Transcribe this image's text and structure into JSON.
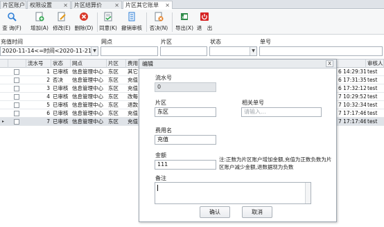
{
  "tabs": [
    {
      "label": "片区账户"
    },
    {
      "label": "权限设置"
    },
    {
      "label": "片区结算价"
    },
    {
      "label": "片区其它账单"
    }
  ],
  "tab_close": "×",
  "toolbar": {
    "query": "查 询(F)",
    "add": "增加(A)",
    "edit": "修改(E)",
    "delete": "删除(D)",
    "approve": "同意(K)",
    "revoke": "撤销审核",
    "reject": "否决(N)",
    "export": "导出(X)",
    "exit": "退　出"
  },
  "filters": {
    "time_label": "充值时间",
    "time_value": "2020-11-14<=时间<2020-11-21",
    "outlet_label": "网点",
    "outlet_value": "",
    "area_label": "片区",
    "area_value": "",
    "status_label": "状态",
    "status_value": "",
    "bill_label": "单号",
    "bill_value": ""
  },
  "grid": {
    "headers": [
      "流水号",
      "状态",
      "网点",
      "片区",
      "费用",
      "审核人"
    ],
    "rows": [
      {
        "no": "1",
        "status": "已审核",
        "outlet": "信息管理中心",
        "area": "东区",
        "fee": "其它",
        "time": "6 14:29:31",
        "auditor": "test"
      },
      {
        "no": "2",
        "status": "否决",
        "outlet": "信息管理中心",
        "area": "东区",
        "fee": "充值",
        "time": "6 17:31:35",
        "auditor": "test"
      },
      {
        "no": "3",
        "status": "已审核",
        "outlet": "信息管理中心",
        "area": "东区",
        "fee": "充值",
        "time": "6 17:32:12",
        "auditor": "test"
      },
      {
        "no": "4",
        "status": "已审核",
        "outlet": "信息管理中心",
        "area": "东区",
        "fee": "改每",
        "time": "7 10:29:52",
        "auditor": "test"
      },
      {
        "no": "5",
        "status": "已审核",
        "outlet": "信息管理中心",
        "area": "东区",
        "fee": "退款",
        "time": "7 10:32:34",
        "auditor": "test"
      },
      {
        "no": "6",
        "status": "已审核",
        "outlet": "信息管理中心",
        "area": "东区",
        "fee": "充值",
        "time": "7 17:17:46",
        "auditor": "test"
      },
      {
        "no": "7",
        "status": "已审核",
        "outlet": "信息管理中心",
        "area": "东区",
        "fee": "充值",
        "time": "7 17:17:46",
        "auditor": "test"
      }
    ],
    "row_pointer": "▸"
  },
  "dialog": {
    "title": "编辑",
    "close": "X",
    "serial_label": "流水号",
    "serial_value": "0",
    "area_label": "片区",
    "area_value": "东区",
    "related_label": "相关单号",
    "related_placeholder": "请输入...",
    "fee_label": "费用名",
    "fee_value": "充值",
    "amount_label": "金额",
    "amount_value": "111",
    "amount_note": "注:正数为片区账户增加金额,充值为正数负数为片区账户减少金额,退数据现为负数",
    "remark_label": "备注",
    "remark_value": "",
    "confirm": "确认",
    "cancel": "取消"
  },
  "colors": {
    "accent_blue": "#2f7fd6",
    "delete_red": "#d93a2b",
    "exit_red": "#d62424",
    "toolbar_bg": "#f6f7f8"
  }
}
